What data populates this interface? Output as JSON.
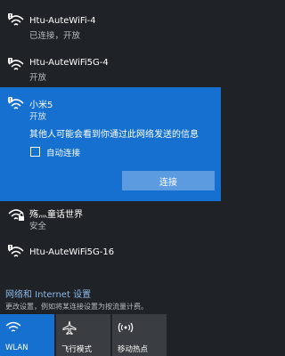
{
  "networks": [
    {
      "name": "Htu-AuteWiFi-4",
      "status": "已连接，开放",
      "secured": false
    },
    {
      "name": "Htu-AuteWiFi5G-4",
      "status": "开放",
      "secured": false
    },
    {
      "name": "小米5",
      "status": "开放",
      "secured": false
    },
    {
      "name": "殇灬童话世界",
      "status": "安全",
      "secured": true
    },
    {
      "name": "Htu-AuteWiFi5G-16",
      "status": "",
      "secured": false
    }
  ],
  "expanded": {
    "warning": "其他人可能会看到你通过此网络发送的信息",
    "auto_connect_label": "自动连接",
    "auto_connect_checked": false,
    "connect_label": "连接"
  },
  "settings": {
    "title": "网络和 Internet 设置",
    "description": "更改设置，例如将某连接设置为按流量计费。"
  },
  "quick_actions": [
    {
      "label": "WLAN",
      "icon": "wifi-icon",
      "active": true
    },
    {
      "label": "飞行模式",
      "icon": "airplane-icon",
      "active": false
    },
    {
      "label": "移动热点",
      "icon": "hotspot-icon",
      "active": false
    }
  ],
  "colors": {
    "background": "#1f2226",
    "accent": "#1570cf",
    "link": "#8cb8ea",
    "tile": "#3a3d41"
  }
}
